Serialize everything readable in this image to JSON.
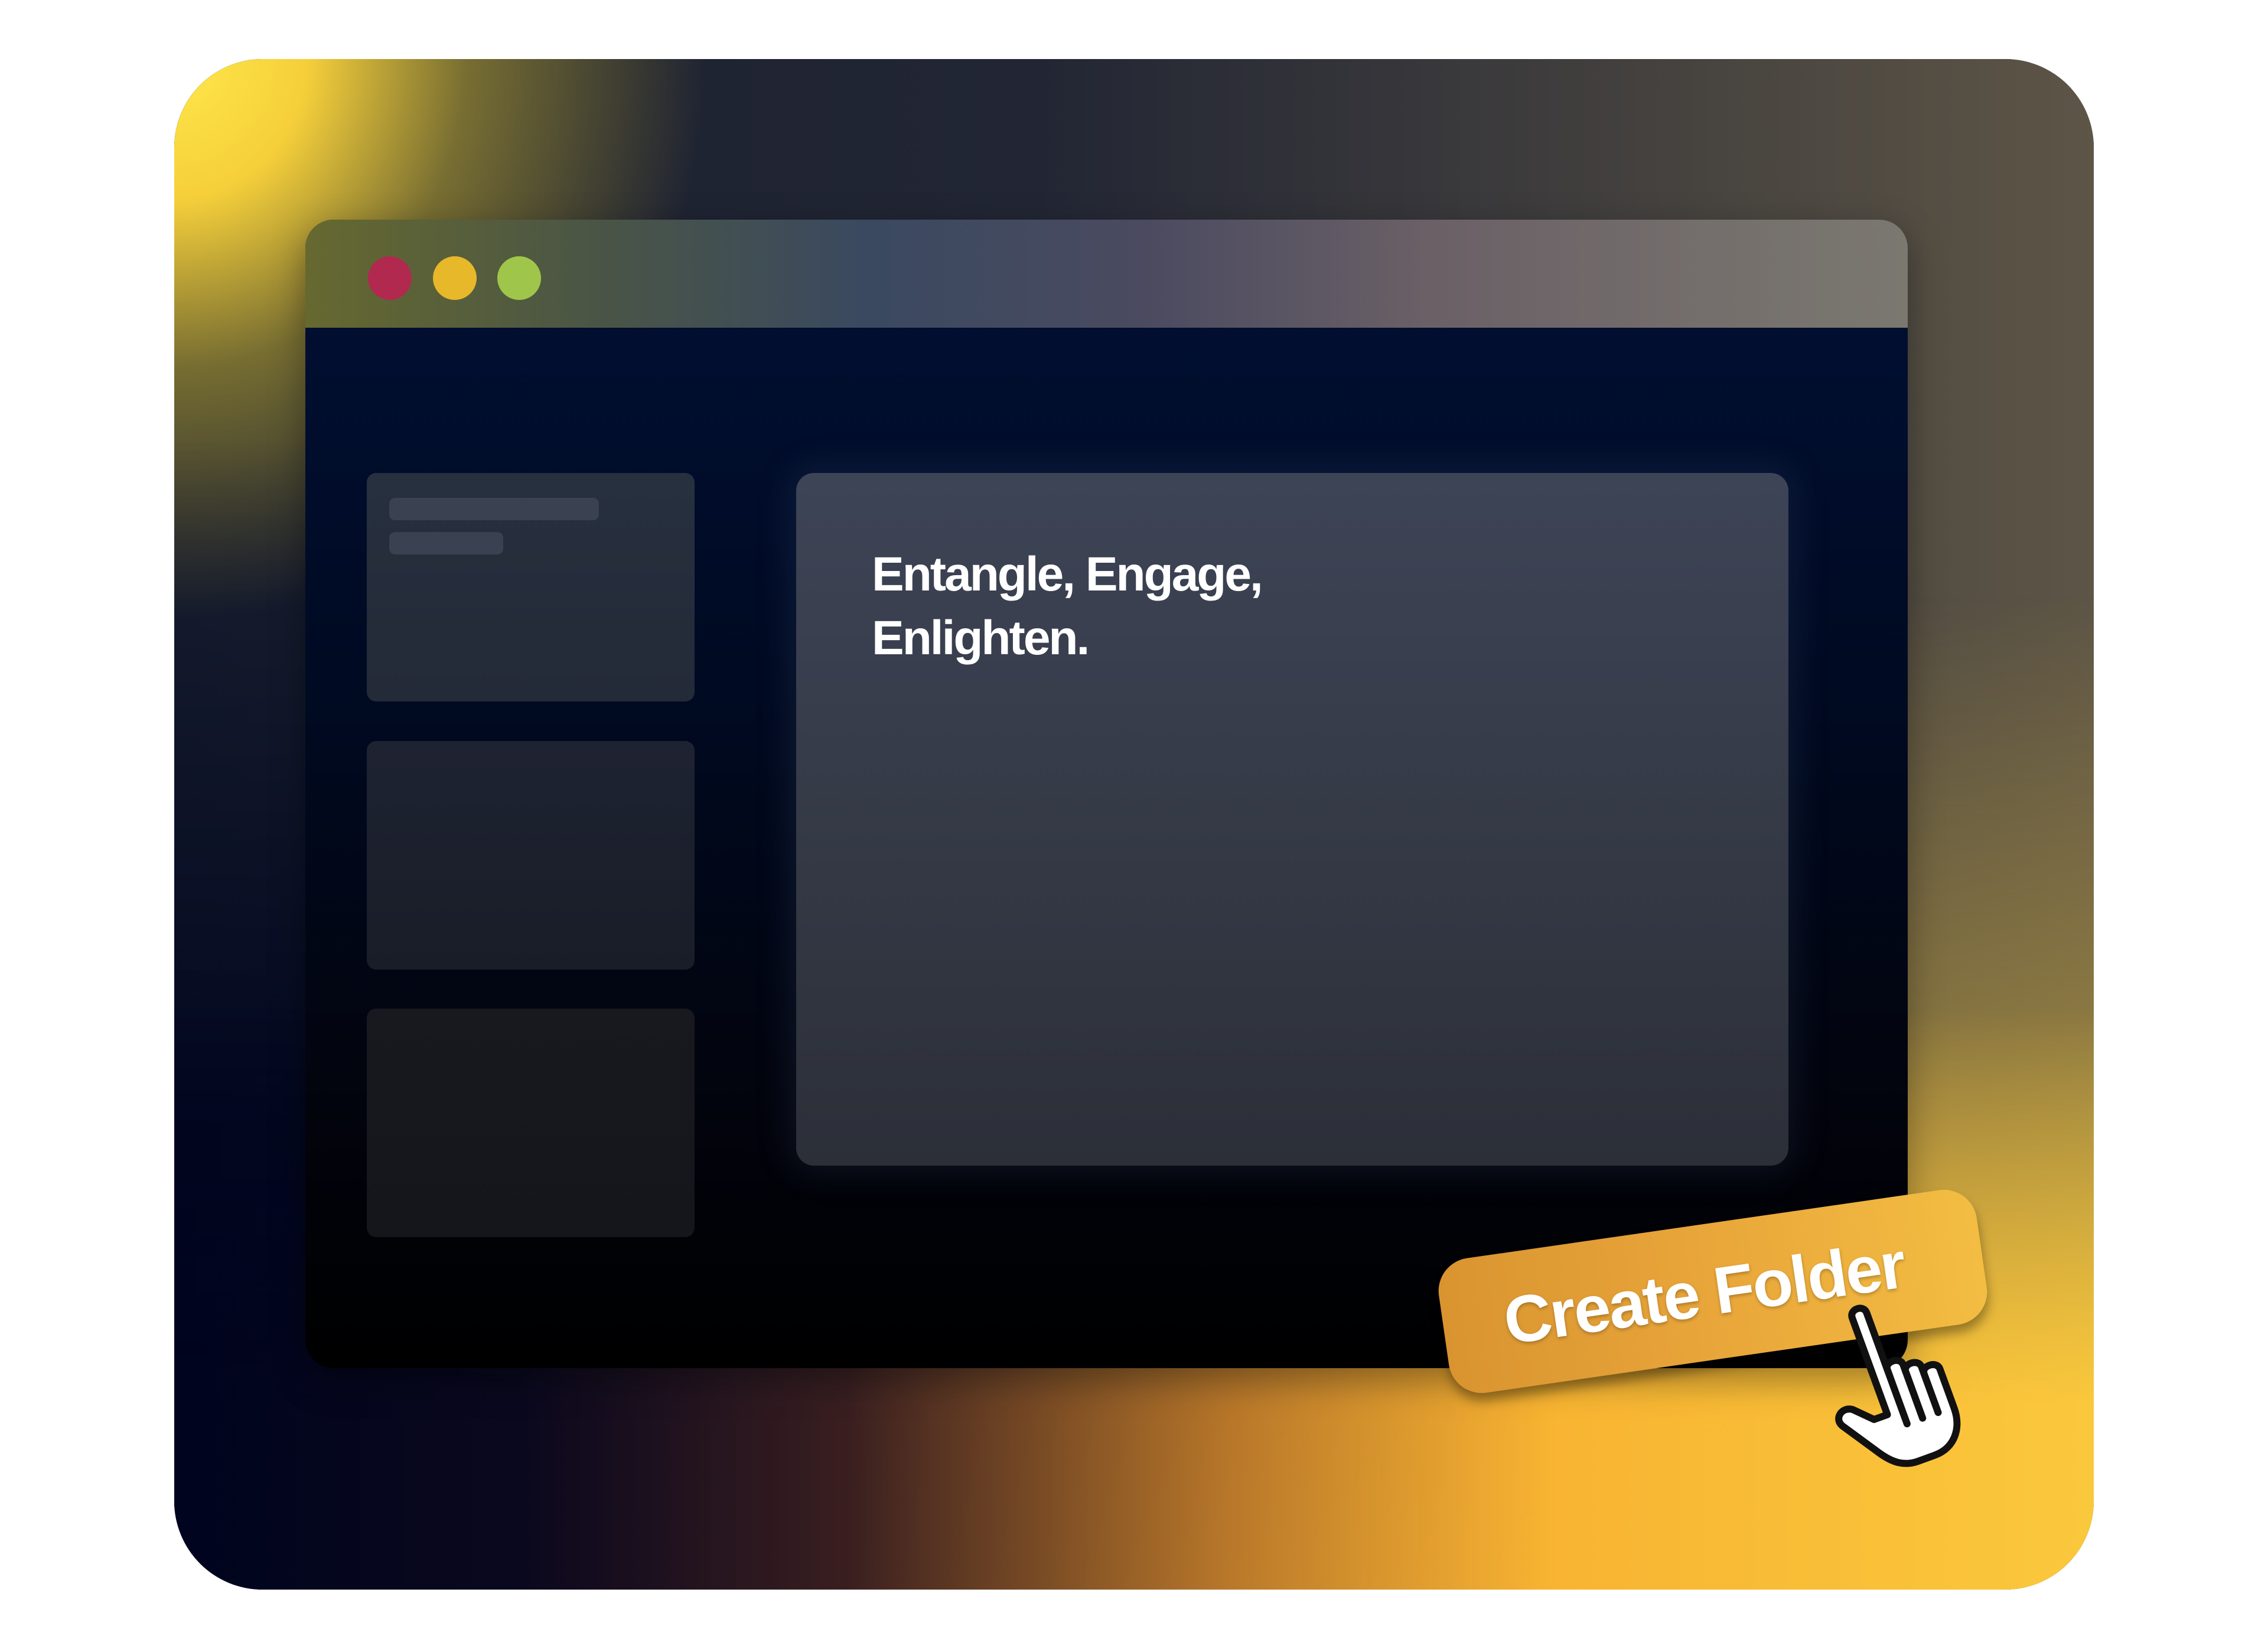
{
  "window": {
    "controls": [
      "close",
      "minimize",
      "maximize"
    ]
  },
  "main": {
    "headline_line1": "Entangle, Engage,",
    "headline_line2": "Enlighten."
  },
  "cta": {
    "label": "Create Folder"
  },
  "icons": {
    "cursor": "hand-pointer-icon"
  },
  "colors": {
    "close_dot": "#b1294f",
    "minimize_dot": "#e6b82a",
    "maximize_dot": "#9fc64a",
    "button_accent": "#e9a63a",
    "window_bg": "#011035"
  }
}
